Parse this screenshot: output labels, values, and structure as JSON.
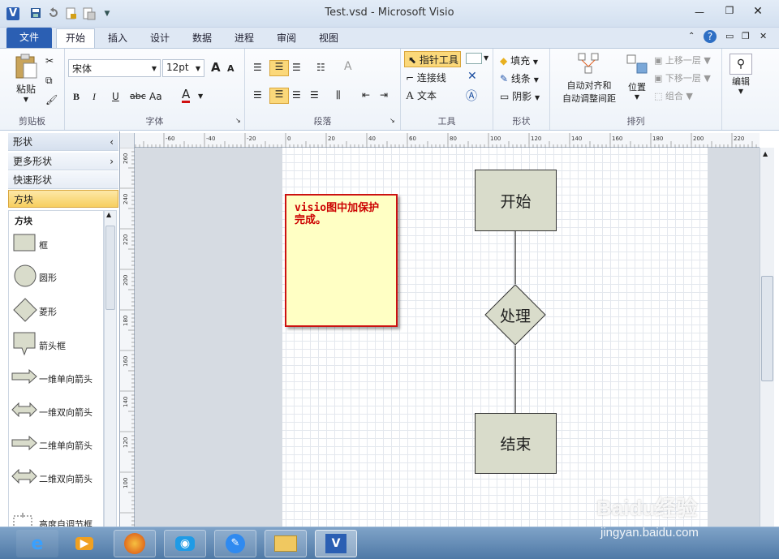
{
  "window": {
    "title": "Test.vsd - Microsoft Visio",
    "app_icon": "V"
  },
  "quick_access": {
    "icons": [
      "save-icon",
      "undo-icon",
      "lock-document-icon",
      "protect-document-icon",
      "customize-arrow-icon"
    ]
  },
  "tabs": [
    {
      "label": "文件"
    },
    {
      "label": "开始"
    },
    {
      "label": "插入"
    },
    {
      "label": "设计"
    },
    {
      "label": "数据"
    },
    {
      "label": "进程"
    },
    {
      "label": "审阅"
    },
    {
      "label": "视图"
    }
  ],
  "ribbon": {
    "clipboard": {
      "paste": "粘贴",
      "group": "剪贴板"
    },
    "font": {
      "name": "宋体",
      "size": "12pt",
      "bold": "B",
      "italic": "I",
      "underline": "U",
      "strike": "abc",
      "case": "Aa",
      "color_letter": "A",
      "grow": "A",
      "shrink": "A",
      "group": "字体"
    },
    "paragraph": {
      "group": "段落"
    },
    "tools": {
      "pointer": "指针工具",
      "connector": "连接线",
      "text": "文本",
      "text_glyph": "A",
      "group": "工具"
    },
    "shape": {
      "fill": "填充",
      "line": "线条",
      "shadow": "阴影",
      "group": "形状"
    },
    "arrange": {
      "auto_align": "自动对齐和",
      "auto_space": "自动调整间距",
      "position": "位置",
      "bring_forward": "上移一层",
      "send_backward": "下移一层",
      "group_btn": "组合",
      "group": "排列"
    },
    "editing": {
      "label": "编辑"
    }
  },
  "shapes_panel": {
    "header": "形状",
    "more": "更多形状",
    "quick": "快速形状",
    "selected": "方块",
    "stencil_title": "方块",
    "items": [
      {
        "label": "框"
      },
      {
        "label": "圆形"
      },
      {
        "label": "菱形"
      },
      {
        "label": "箭头框"
      },
      {
        "label": "一维单向箭头"
      },
      {
        "label": "一维双向箭头"
      },
      {
        "label": "二维单向箭头"
      },
      {
        "label": "二维双向箭头"
      },
      {
        "label": "高度自调节框"
      }
    ]
  },
  "ruler": {
    "h_ticks": [
      "-60",
      "-40",
      "-20",
      "0",
      "20",
      "40",
      "60",
      "80",
      "100",
      "120",
      "140",
      "160",
      "180",
      "200",
      "220"
    ],
    "v_ticks": [
      "260",
      "240",
      "220",
      "200",
      "180",
      "160",
      "140",
      "120",
      "100"
    ]
  },
  "diagram": {
    "start": "开始",
    "process": "处理",
    "end": "结束",
    "note": "visio图中加保护完成。"
  },
  "colors": {
    "accent": "#2b5fb3",
    "shape_fill": "#d9dccb",
    "note_fill": "#ffffc4",
    "note_border": "#cc1111",
    "note_text": "#cc0000",
    "selection": "#f7cf5f"
  },
  "taskbar": {
    "items": [
      "ie-icon",
      "media-player-icon",
      "firefox-icon",
      "chat-icon",
      "note-icon",
      "file-explorer-icon",
      "visio-icon"
    ]
  },
  "watermark": {
    "brand": "Baidu经验",
    "url": "jingyan.baidu.com"
  }
}
